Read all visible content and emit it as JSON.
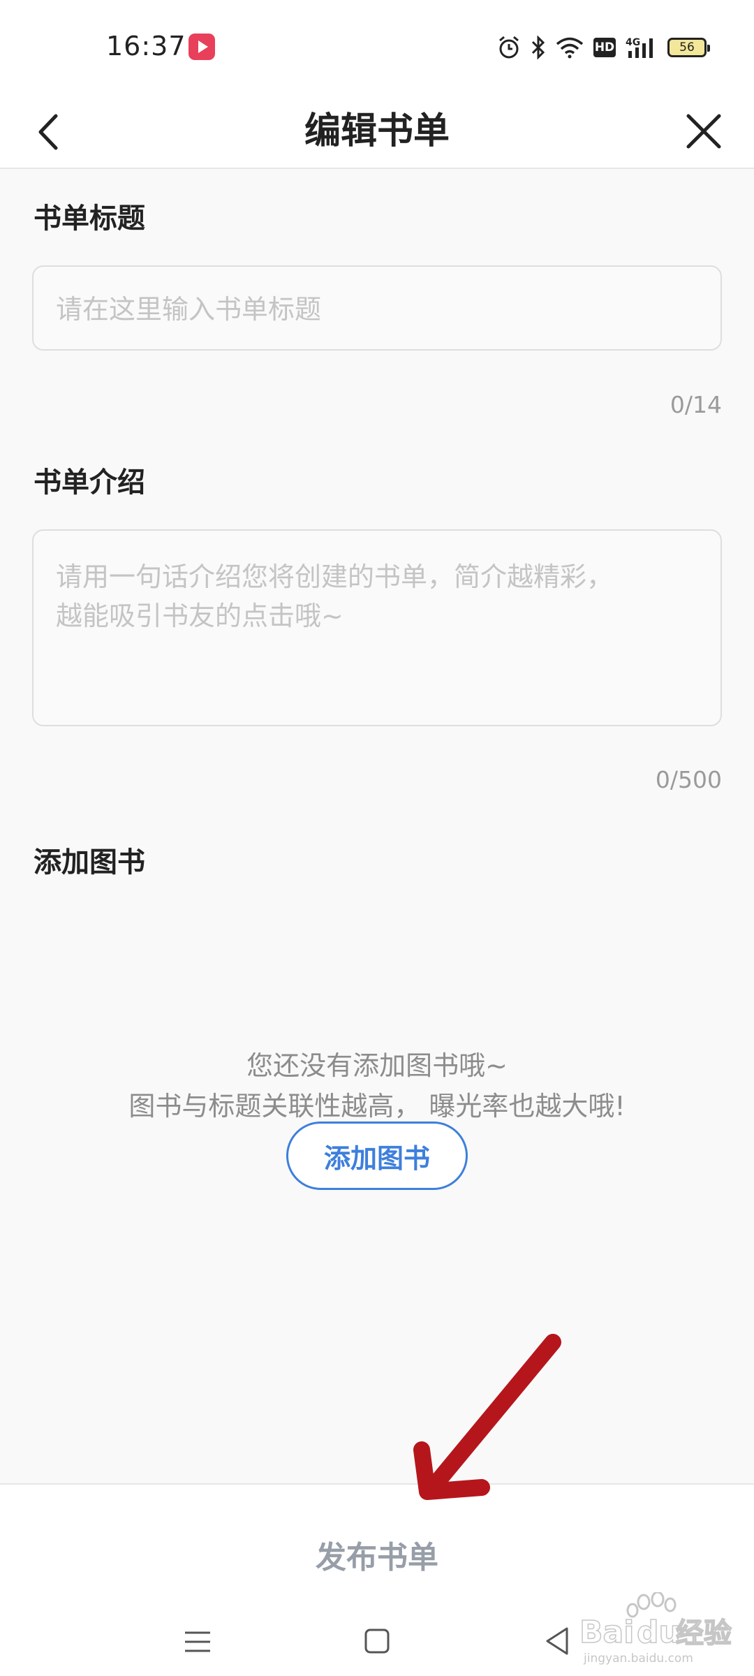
{
  "status_bar": {
    "time": "16:37",
    "icons": [
      "app-notification-icon",
      "alarm-icon",
      "bluetooth-icon",
      "wifi-icon",
      "hd-icon",
      "4g-signal-icon",
      "battery-icon"
    ],
    "hd_label": "HD",
    "network_label": "4G",
    "battery_level": "56"
  },
  "nav": {
    "title": "编辑书单",
    "back_icon": "chevron-left-icon",
    "close_icon": "close-icon"
  },
  "form": {
    "title_section": {
      "label": "书单标题",
      "placeholder": "请在这里输入书单标题",
      "value": "",
      "counter": "0/14"
    },
    "intro_section": {
      "label": "书单介绍",
      "placeholder_line1": "请用一句话介绍您将创建的书单，简介越精彩，",
      "placeholder_line2": "越能吸引书友的点击哦~",
      "value": "",
      "counter": "0/500"
    },
    "books_section": {
      "label": "添加图书",
      "empty_line1": "您还没有添加图书哦~",
      "empty_line2": "图书与标题关联性越高， 曝光率也越大哦!",
      "add_button": "添加图书"
    }
  },
  "footer": {
    "publish_button": "发布书单"
  },
  "system_nav": {
    "icons": [
      "menu-icon",
      "home-square-icon",
      "back-triangle-icon"
    ]
  },
  "colors": {
    "accent": "#3d7fdc",
    "annotation_arrow": "#b5161c",
    "disabled_text": "#979ea8",
    "placeholder": "#c4c4c4"
  },
  "watermark": {
    "brand": "Baidu经验",
    "url": "jingyan.baidu.com"
  }
}
